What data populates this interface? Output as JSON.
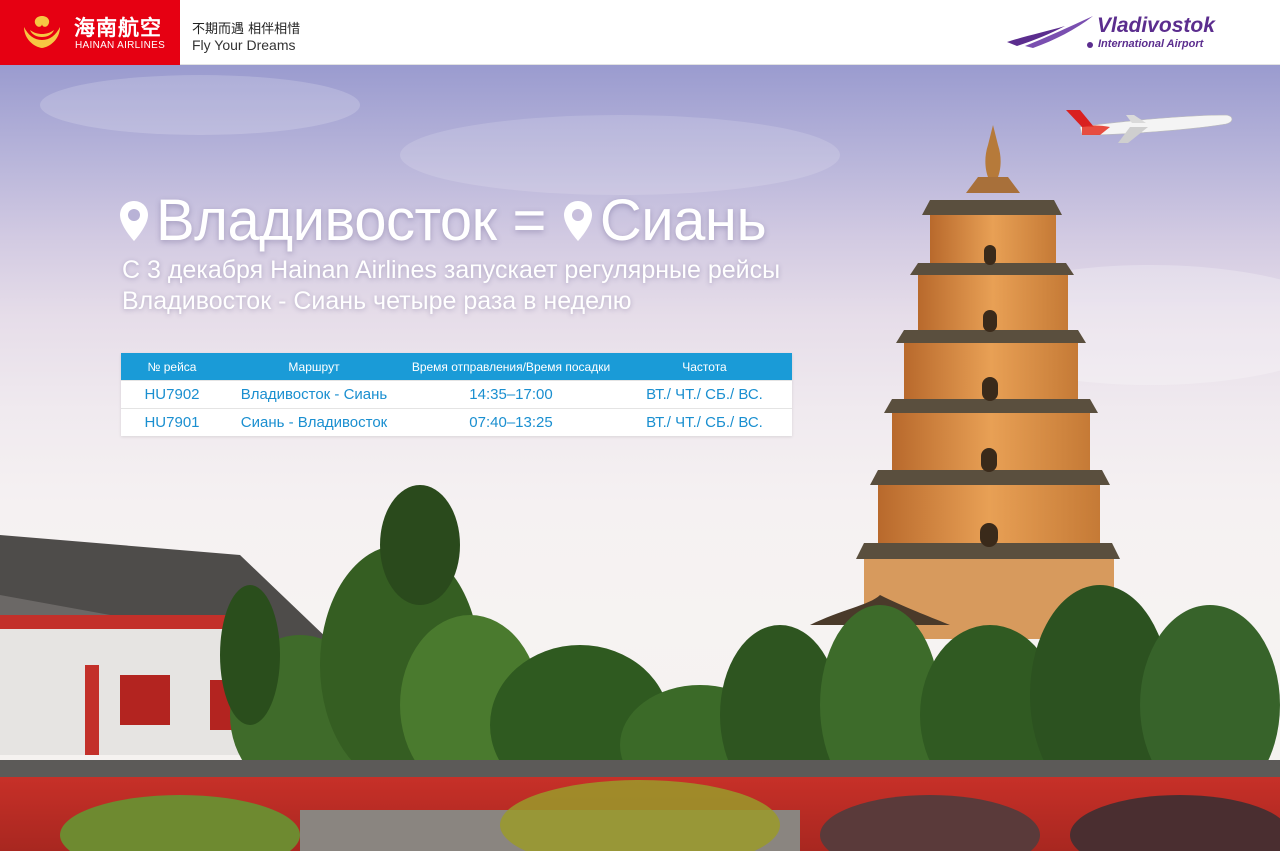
{
  "header": {
    "hainan_name_cn": "海南航空",
    "hainan_name_en": "HAINAN AIRLINES",
    "slogan_cn": "不期而遇 相伴相惜",
    "slogan_en": "Fly Your Dreams",
    "airport_name": "Vladivostok",
    "airport_sub": "International Airport",
    "colors": {
      "hainan_red": "#e60012",
      "airport_purple": "#5b2d8e"
    },
    "icons": [
      "hainan-emblem-icon",
      "vladivostok-swoosh-icon"
    ]
  },
  "hero": {
    "origin": "Владивосток",
    "separator": "=",
    "destination": "Сиань",
    "subtitle": "С 3 декабря Hainan Airlines запускает регулярные рейсы Владивосток - Сиань четыре раза в неделю",
    "icons": [
      "location-pin-icon",
      "airplane-icon",
      "pagoda-illustration"
    ]
  },
  "schedule": {
    "headers": [
      "№ рейса",
      "Маршрут",
      "Время отправления/Время посадки",
      "Частота"
    ],
    "rows": [
      {
        "flight": "HU7902",
        "route": "Владивосток - Сиань",
        "time": "14:35‒17:00",
        "frequency": "ВТ./ ЧТ./ СБ./ ВС."
      },
      {
        "flight": "HU7901",
        "route": "Сиань - Владивосток",
        "time": "07:40‒13:25",
        "frequency": "ВТ./ ЧТ./ СБ./ ВС."
      }
    ],
    "colors": {
      "header_bg": "#1a9bd7",
      "cell_text": "#1a8fd0"
    }
  }
}
